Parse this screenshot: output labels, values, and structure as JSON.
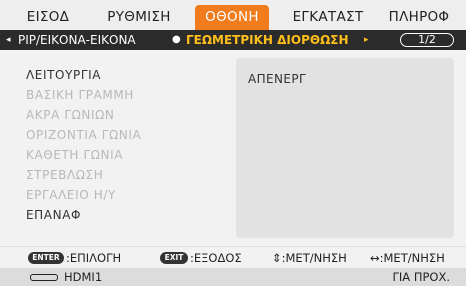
{
  "tabs": [
    {
      "label": "ΕΙΣΟΔ",
      "active": false
    },
    {
      "label": "ΡΥΘΜΙΣΗ",
      "active": false
    },
    {
      "label": "ΟΘΟΝΗ",
      "active": true
    },
    {
      "label": "ΕΓΚΑΤΑΣΤ",
      "active": false
    },
    {
      "label": "ΠΛΗΡΟΦ",
      "active": false
    }
  ],
  "breadcrumb": {
    "prev_arrow": "◂",
    "prev": "PIP/ΕΙΚΟΝΑ-ΕΙΚΟΝΑ",
    "separator": "●",
    "current": "ΓΕΩΜΕΤΡΙΚΗ ΔΙΟΡΘΩΣΗ",
    "next_arrow": "▸",
    "page": "1/2"
  },
  "menu_items": [
    {
      "label": "ΛΕΙΤΟΥΡΓΙΑ",
      "enabled": true
    },
    {
      "label": "ΒΑΣΙΚΗ ΓΡΑΜΜΗ",
      "enabled": false
    },
    {
      "label": "ΑΚΡΑ ΓΩΝΙΩΝ",
      "enabled": false
    },
    {
      "label": "ΟΡΙΖΟΝΤΙΑ ΓΩΝΙΑ",
      "enabled": false
    },
    {
      "label": "ΚΑΘΕΤΗ ΓΩΝΙΑ",
      "enabled": false
    },
    {
      "label": "ΣΤΡΕΒΛΩΣΗ",
      "enabled": false
    },
    {
      "label": "ΕΡΓΑΛΕΙΟ Η/Υ",
      "enabled": false
    },
    {
      "label": "ΕΠΑΝΑΦ",
      "enabled": true
    }
  ],
  "value": "ΑΠΕΝΕΡΓ",
  "help": {
    "enter_key": "ENTER",
    "enter_text": ":ΕΠΙΛΟΓΗ",
    "exit_key": "EXIT",
    "exit_text": ":ΕΞΟΔΟΣ",
    "updown": "⇕:ΜΕΤ/ΝΗΣΗ",
    "leftright": "↔:ΜΕΤ/ΝΗΣΗ"
  },
  "status": {
    "source_icon": "hdmi-connector-icon",
    "source": "HDMI1",
    "right": "ΓΙΑ ΠΡΟΧ."
  },
  "colors": {
    "active_tab": "#f07c1e",
    "breadcrumb_current": "#ffbf1a",
    "breadcrumb_bg": "#2b2b2b"
  }
}
